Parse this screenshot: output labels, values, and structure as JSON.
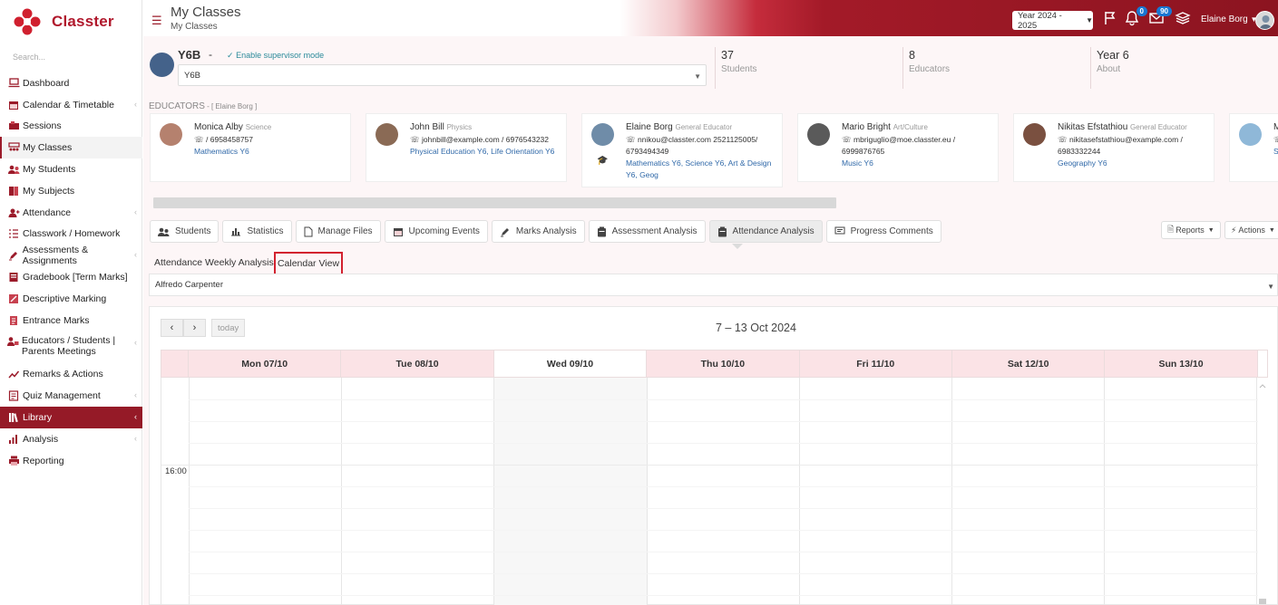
{
  "app": {
    "name": "Classter",
    "brand_color": "#9b1b2a"
  },
  "sidebar": {
    "search_placeholder": "Search...",
    "items": [
      {
        "label": "Dashboard",
        "icon": "laptop-icon"
      },
      {
        "label": "Calendar & Timetable",
        "icon": "calendar-icon",
        "chevron": true
      },
      {
        "label": "Sessions",
        "icon": "sessions-icon"
      },
      {
        "label": "My Classes",
        "icon": "classes-icon",
        "state": "current"
      },
      {
        "label": "My Students",
        "icon": "students-icon"
      },
      {
        "label": "My Subjects",
        "icon": "book-icon"
      },
      {
        "label": "Attendance",
        "icon": "attendance-icon",
        "chevron": true
      },
      {
        "label": "Classwork / Homework",
        "icon": "list-icon"
      },
      {
        "label": "Assessments & Assignments",
        "icon": "pencil-icon",
        "chevron": true
      },
      {
        "label": "Gradebook [Term Marks]",
        "icon": "gradebook-icon"
      },
      {
        "label": "Descriptive Marking",
        "icon": "marking-icon"
      },
      {
        "label": "Entrance Marks",
        "icon": "entrance-icon"
      },
      {
        "label": "Educators / Students | Parents Meetings",
        "icon": "meetings-icon",
        "chevron": true
      },
      {
        "label": "Remarks & Actions",
        "icon": "remarks-icon"
      },
      {
        "label": "Quiz Management",
        "icon": "quiz-icon",
        "chevron": true
      },
      {
        "label": "Library",
        "icon": "library-icon",
        "chevron": true,
        "state": "highlighted"
      },
      {
        "label": "Analysis",
        "icon": "analysis-icon",
        "chevron": true
      },
      {
        "label": "Reporting",
        "icon": "printer-icon"
      }
    ]
  },
  "header": {
    "title": "My Classes",
    "breadcrumb": "My Classes",
    "year": "Year 2024 - 2025",
    "notifications_count": "0",
    "messages_count": "90",
    "user_name": "Elaine Borg"
  },
  "class_info": {
    "name": "Y6B",
    "dash": "-",
    "supervisor_link": "Enable supervisor mode",
    "selected_class": "Y6B",
    "stats": [
      {
        "value": "37",
        "label": "Students"
      },
      {
        "value": "8",
        "label": "Educators"
      },
      {
        "value": "Year 6",
        "label": "About"
      }
    ]
  },
  "educators_section": {
    "heading": "EDUCATORS",
    "heading_note": " - [ Elaine Borg ]",
    "cards": [
      {
        "name": "Monica Alby",
        "role": "Science",
        "contact": "/ 6958458757",
        "subjects": "Mathematics Y6",
        "photo_color": "#b5816e"
      },
      {
        "name": "John Bill",
        "role": "Physics",
        "contact": "johnbill@example.com / 6976543232",
        "subjects": "Physical Education Y6, Life Orientation Y6",
        "photo_color": "#8a6a55"
      },
      {
        "name": "Elaine Borg",
        "role": "General Educator",
        "contact": "nnikou@classter.com 2521125005/ 6793494349",
        "subjects": "Mathematics Y6, Science Y6, Art & Design Y6, Geog",
        "photo_color": "#6f8ca8"
      },
      {
        "name": "Mario Bright",
        "role": "Art/Culture",
        "contact": "mbriguglio@moe.classter.eu / 6999876765",
        "subjects": "Music Y6",
        "photo_color": "#5a5a5a"
      },
      {
        "name": "Nikitas Efstathiou",
        "role": "General Educator",
        "contact": "nikitasefstathiou@example.com / 6983332244",
        "subjects": "Geography Y6",
        "photo_color": "#7a5040"
      },
      {
        "name": "M",
        "role": "",
        "contact": "6",
        "subjects": "S",
        "photo_color": "#8fb8d8"
      }
    ]
  },
  "tabs": [
    {
      "label": "Students",
      "icon": "students-icon"
    },
    {
      "label": "Statistics",
      "icon": "chart-icon"
    },
    {
      "label": "Manage Files",
      "icon": "file-icon"
    },
    {
      "label": "Upcoming Events",
      "icon": "calendar-icon"
    },
    {
      "label": "Marks Analysis",
      "icon": "pencil-icon"
    },
    {
      "label": "Assessment Analysis",
      "icon": "clipboard-icon"
    },
    {
      "label": "Attendance Analysis",
      "icon": "clipboard-icon",
      "active": true
    },
    {
      "label": "Progress Comments",
      "icon": "comment-icon"
    }
  ],
  "toolbar": {
    "reports_label": "Reports",
    "actions_label": "Actions"
  },
  "subtabs": {
    "weekly": "Attendance Weekly Analysis",
    "calendar": "Calendar View"
  },
  "student_select": {
    "value": "Alfredo Carpenter"
  },
  "calendar": {
    "prev": "‹",
    "next": "›",
    "today_label": "today",
    "title": "7 – 13 Oct 2024",
    "days": [
      "Mon 07/10",
      "Tue 08/10",
      "Wed 09/10",
      "Thu 10/10",
      "Fri 11/10",
      "Sat 12/10",
      "Sun 13/10"
    ],
    "today_index": 2,
    "time_label": "16:00"
  }
}
